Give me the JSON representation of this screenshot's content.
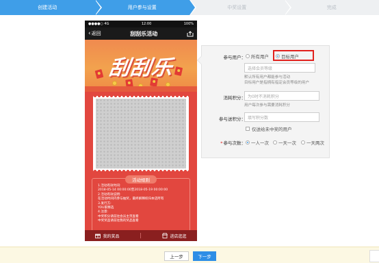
{
  "stepper": {
    "steps": [
      {
        "label": "创建活动",
        "state": "done"
      },
      {
        "label": "用户参与设置",
        "state": "active"
      },
      {
        "label": "中奖设置",
        "state": "pending"
      },
      {
        "label": "完成",
        "state": "pending"
      }
    ]
  },
  "phone": {
    "status": {
      "carrier": "●●●●○ 4G",
      "time": "12:00",
      "battery": "100%"
    },
    "nav": {
      "back_label": "返回",
      "title": "刮刮乐活动",
      "share_icon": "share-icon"
    },
    "hero_text": "刮刮乐",
    "rules": {
      "title": "活动规则",
      "lines": [
        "1.活动有效时间:",
        "2018-05-14 00:00:00至2018-05-19 00:00:00",
        "2.活动有效说明:",
        "在活动时间内参与抽奖，最终解释权归本店所有",
        "3.发行方:",
        "YOU家精选",
        "4.注意:",
        "中奖积分请前往会员主页查看",
        "中奖奖品请前往我的奖品查看"
      ]
    },
    "bottom": {
      "my_prizes": "我的奖品",
      "go_shop": "进店逛逛"
    }
  },
  "settings": {
    "participants": {
      "label": "参与用户：",
      "option_all": "所有用户",
      "option_target": "目标用户",
      "selected": "目标用户",
      "member_level_placeholder": "选择会员等级",
      "hint1": "默认所有用户都能参与活动",
      "hint2": "目标用户是指拥有指定会员等级的用户"
    },
    "consume_points": {
      "label": "消耗积分：",
      "placeholder": "为0时不消耗积分",
      "hint": "用户每次参与需要消耗积分"
    },
    "gift_points": {
      "label": "参与送积分：",
      "placeholder": "填写积分数",
      "checkbox_label": "仅送给未中奖的用户"
    },
    "times": {
      "required_mark": "*",
      "label": "参与次数：",
      "options": [
        "一人一次",
        "一天一次",
        "一天两次"
      ],
      "selected": "一人一次"
    }
  },
  "footer": {
    "prev_label": "上一步",
    "next_label": "下一步"
  },
  "colors": {
    "accent": "#3f9ee8",
    "highlight_box": "#e1201c",
    "phone_bg": "#e2473f"
  }
}
